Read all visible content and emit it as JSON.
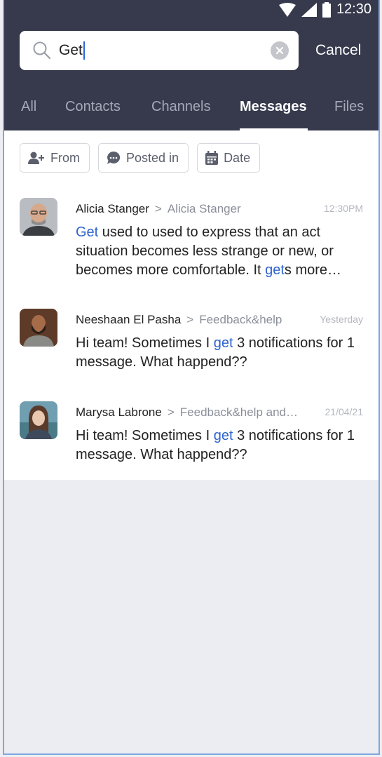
{
  "status": {
    "time": "12:30"
  },
  "search": {
    "value": "Get",
    "cancel_label": "Cancel"
  },
  "tabs": [
    {
      "label": "All"
    },
    {
      "label": "Contacts"
    },
    {
      "label": "Channels"
    },
    {
      "label": "Messages",
      "active": true
    },
    {
      "label": "Files"
    }
  ],
  "filters": {
    "from": "From",
    "posted_in": "Posted in",
    "date": "Date"
  },
  "results": [
    {
      "sender": "Alicia Stanger",
      "channel": "Alicia Stanger",
      "time": "12:30PM",
      "parts": {
        "a": "Get",
        "b": " used to used to express that an act situation becomes less strange or new, or becomes more comfortable. It ",
        "c": "get",
        "d": "s more…"
      }
    },
    {
      "sender": "Neeshaan El Pasha",
      "channel": "Feedback&help",
      "time": "Yesterday",
      "parts": {
        "a": "Hi team! Sometimes I ",
        "b": "get",
        "c": " 3 notifications for 1 message. What happend??"
      }
    },
    {
      "sender": "Marysa Labrone",
      "channel": "Feedback&help and…",
      "time": "21/04/21",
      "parts": {
        "a": "Hi team! Sometimes I ",
        "b": "get",
        "c": " 3 notifications for 1 message. What happend??"
      }
    }
  ],
  "colors": {
    "header": "#373a4d",
    "highlight": "#2f63cf",
    "background": "#ecedf2"
  },
  "icons": [
    "wifi-icon",
    "signal-icon",
    "battery-icon",
    "search-icon",
    "clear-icon",
    "person-add-icon",
    "chat-bubble-icon",
    "calendar-icon"
  ]
}
